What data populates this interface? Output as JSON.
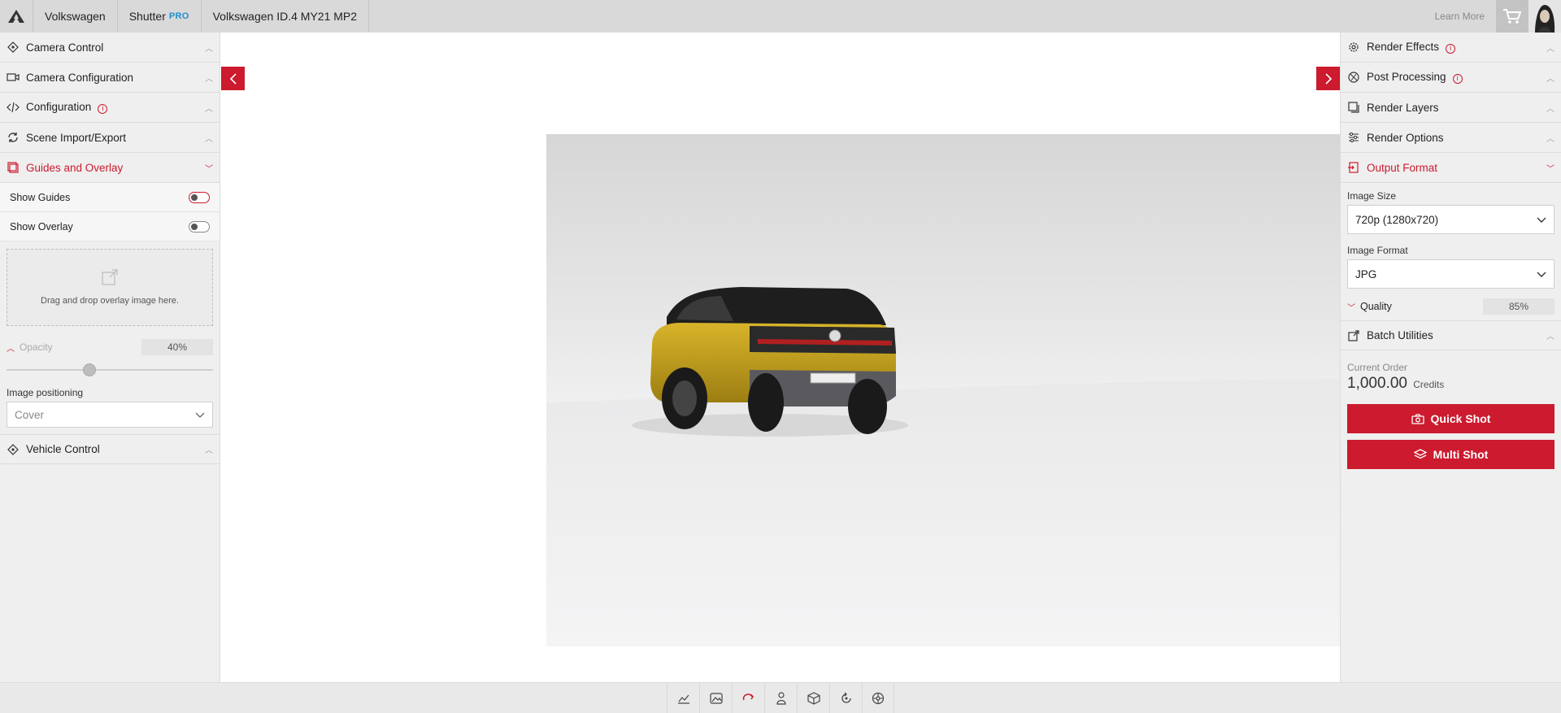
{
  "topbar": {
    "brand": "Volkswagen",
    "app_name": "Shutter",
    "app_badge": "PRO",
    "project": "Volkswagen ID.4 MY21 MP2",
    "learn_more": "Learn More"
  },
  "left_panel": {
    "sections_top": [
      {
        "label": "Camera Control",
        "icon": "camera-move-icon"
      },
      {
        "label": "Camera Configuration",
        "icon": "video-camera-icon"
      },
      {
        "label": "Configuration",
        "icon": "code-icon",
        "has_info": true
      },
      {
        "label": "Scene Import/Export",
        "icon": "sync-icon"
      },
      {
        "label": "Guides and Overlay",
        "icon": "layers-icon",
        "active": true
      }
    ],
    "show_guides_label": "Show Guides",
    "show_overlay_label": "Show Overlay",
    "dropzone_text": "Drag and drop overlay image here.",
    "opacity_label": "Opacity",
    "opacity_value": "40%",
    "opacity_fraction": 0.4,
    "image_positioning_label": "Image positioning",
    "image_positioning_value": "Cover",
    "vehicle_control_label": "Vehicle Control"
  },
  "right_panel": {
    "sections": [
      {
        "label": "Render Effects",
        "icon": "gear-icon",
        "has_info": true
      },
      {
        "label": "Post Processing",
        "icon": "aperture-icon",
        "has_info": true
      },
      {
        "label": "Render Layers",
        "icon": "layers-icon"
      },
      {
        "label": "Render Options",
        "icon": "sliders-icon"
      },
      {
        "label": "Output Format",
        "icon": "export-icon",
        "active": true
      }
    ],
    "image_size_label": "Image Size",
    "image_size_value": "720p (1280x720)",
    "image_format_label": "Image Format",
    "image_format_value": "JPG",
    "quality_label": "Quality",
    "quality_value": "85%",
    "batch_label": "Batch Utilities",
    "current_order_label": "Current Order",
    "credits_value": "1,000.00",
    "credits_unit": "Credits",
    "quick_shot_label": "Quick Shot",
    "multi_shot_label": "Multi Shot"
  },
  "colors": {
    "accent": "#cc1a2e",
    "pro_badge": "#1f8fd0",
    "car_body": "#c9a41f"
  },
  "bottom_toolbar": [
    "chart-line-icon",
    "image-icon",
    "rotate-icon",
    "person-icon",
    "cube-icon",
    "refresh-icon",
    "wheel-icon"
  ]
}
